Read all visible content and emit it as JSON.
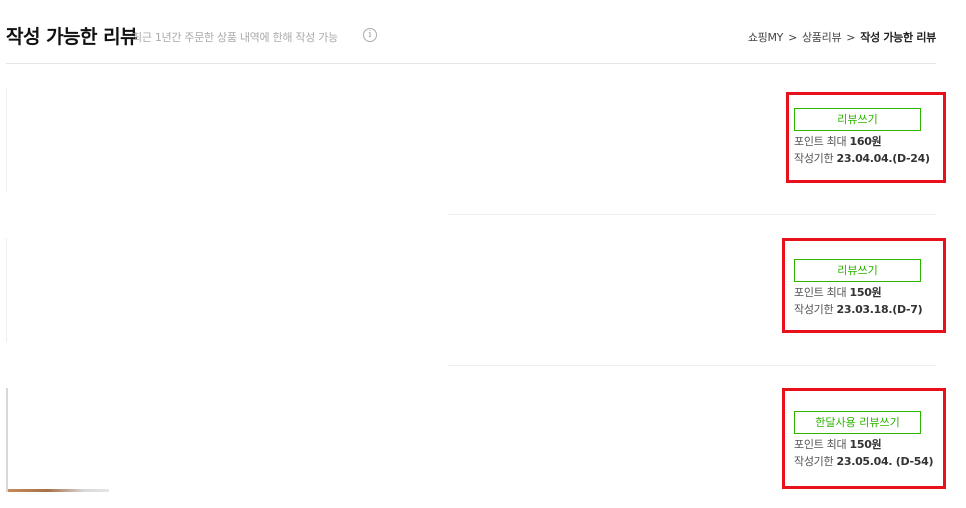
{
  "header": {
    "title": "작성 가능한 리뷰",
    "subtitle": "최근 1년간 주문한 상품 내역에 한해 작성 가능",
    "info_icon": "i",
    "breadcrumb": [
      "쇼핑MY",
      "상품리뷰",
      "작성 가능한 리뷰"
    ],
    "breadcrumb_separator": ">"
  },
  "reviews": [
    {
      "button_label": "리뷰쓰기",
      "points_label": "포인트 최대",
      "points_value": "160원",
      "deadline_label": "작성기한",
      "deadline_value": "23.04.04.(D-24)"
    },
    {
      "button_label": "리뷰쓰기",
      "points_label": "포인트 최대",
      "points_value": "150원",
      "deadline_label": "작성기한",
      "deadline_value": "23.03.18.(D-7)"
    },
    {
      "button_label": "한달사용 리뷰쓰기",
      "points_label": "포인트 최대",
      "points_value": "150원",
      "deadline_label": "작성기한",
      "deadline_value": "23.05.04. (D-54)"
    }
  ],
  "colors": {
    "accent_green": "#2db400",
    "highlight_red": "#e8101a"
  }
}
